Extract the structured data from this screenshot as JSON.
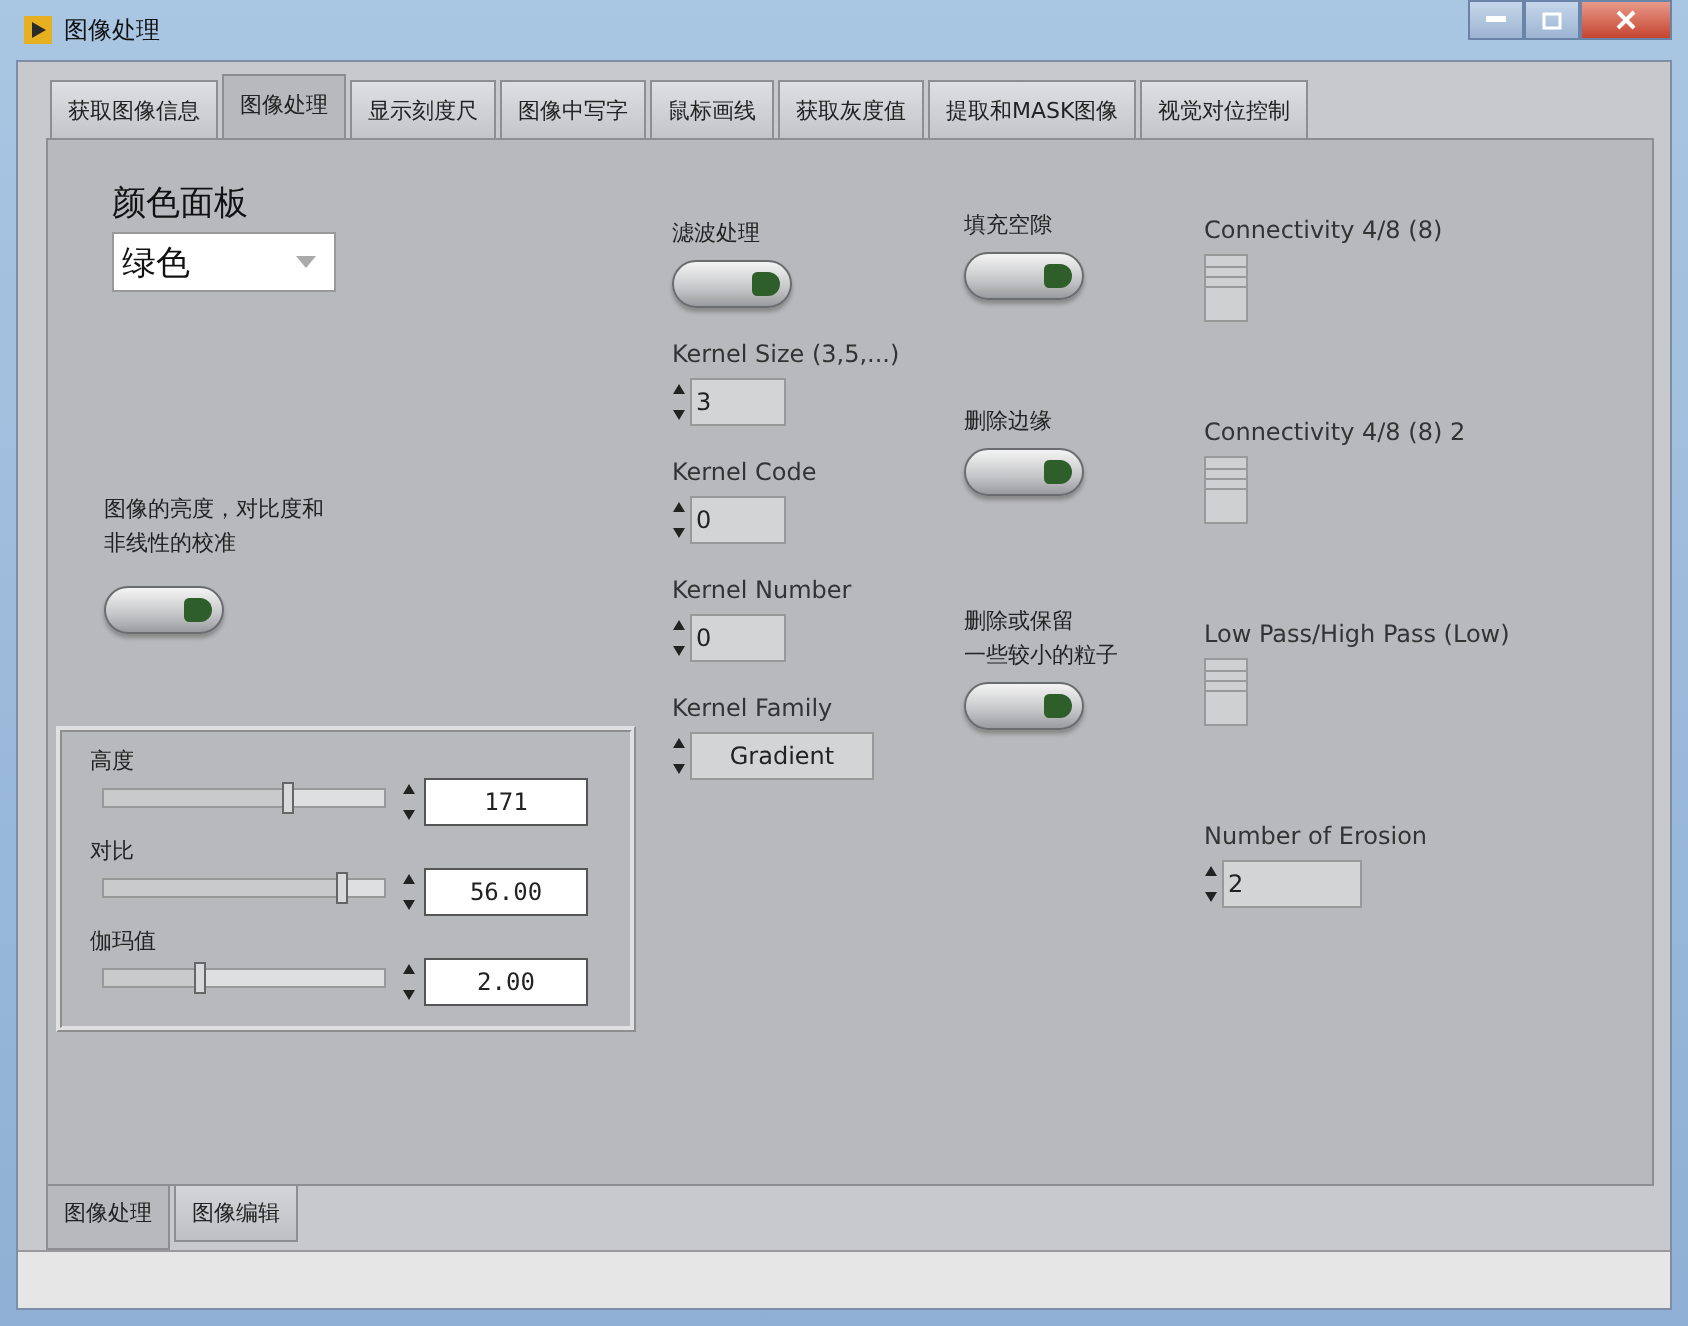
{
  "window": {
    "title": "图像处理"
  },
  "tabs": [
    {
      "label": "获取图像信息",
      "selected": false
    },
    {
      "label": "图像处理",
      "selected": true
    },
    {
      "label": "显示刻度尺",
      "selected": false
    },
    {
      "label": "图像中写字",
      "selected": false
    },
    {
      "label": "鼠标画线",
      "selected": false
    },
    {
      "label": "获取灰度值",
      "selected": false
    },
    {
      "label": "提取和MASK图像",
      "selected": false
    },
    {
      "label": "视觉对位控制",
      "selected": false
    }
  ],
  "color_palette": {
    "label": "颜色面板",
    "value": "绿色"
  },
  "brightness_button": {
    "label_lines": [
      "图像的亮度，对比度和",
      "非线性的校准"
    ]
  },
  "sliders": [
    {
      "label": "高度",
      "level": 0.66,
      "value": "171"
    },
    {
      "label": "对比",
      "level": 0.85,
      "value": "56.00"
    },
    {
      "label": "伽玛值",
      "level": 0.34,
      "value": "2.00"
    }
  ],
  "column_2": [
    {
      "kind": "button",
      "label_lines": [
        "滤波处理"
      ]
    },
    {
      "kind": "numeric",
      "label": "Kernel Size (3,5,...)",
      "value": "3"
    },
    {
      "kind": "numeric",
      "label": "Kernel Code",
      "value": "0"
    },
    {
      "kind": "numeric",
      "label": "Kernel Number",
      "value": "0"
    },
    {
      "kind": "ring",
      "label": "Kernel Family",
      "value": "Gradient"
    }
  ],
  "column_3": [
    {
      "kind": "button",
      "label_lines": [
        "填充空隙"
      ]
    },
    {
      "kind": "button",
      "label_lines": [
        "删除边缘"
      ]
    },
    {
      "kind": "button",
      "label_lines": [
        "删除或保留",
        "一些较小的粒子"
      ]
    }
  ],
  "column_4": [
    {
      "kind": "listbox",
      "label": "Connectivity 4/8 (8)"
    },
    {
      "kind": "listbox",
      "label": "Connectivity 4/8 (8) 2"
    },
    {
      "kind": "listbox",
      "label": "Low Pass/High Pass (Low)"
    },
    {
      "kind": "numeric",
      "label": "Number of Erosion",
      "value": "2"
    }
  ],
  "bottom_tabs": [
    {
      "label": "图像处理",
      "selected": true
    },
    {
      "label": "图像编辑",
      "selected": false
    }
  ]
}
